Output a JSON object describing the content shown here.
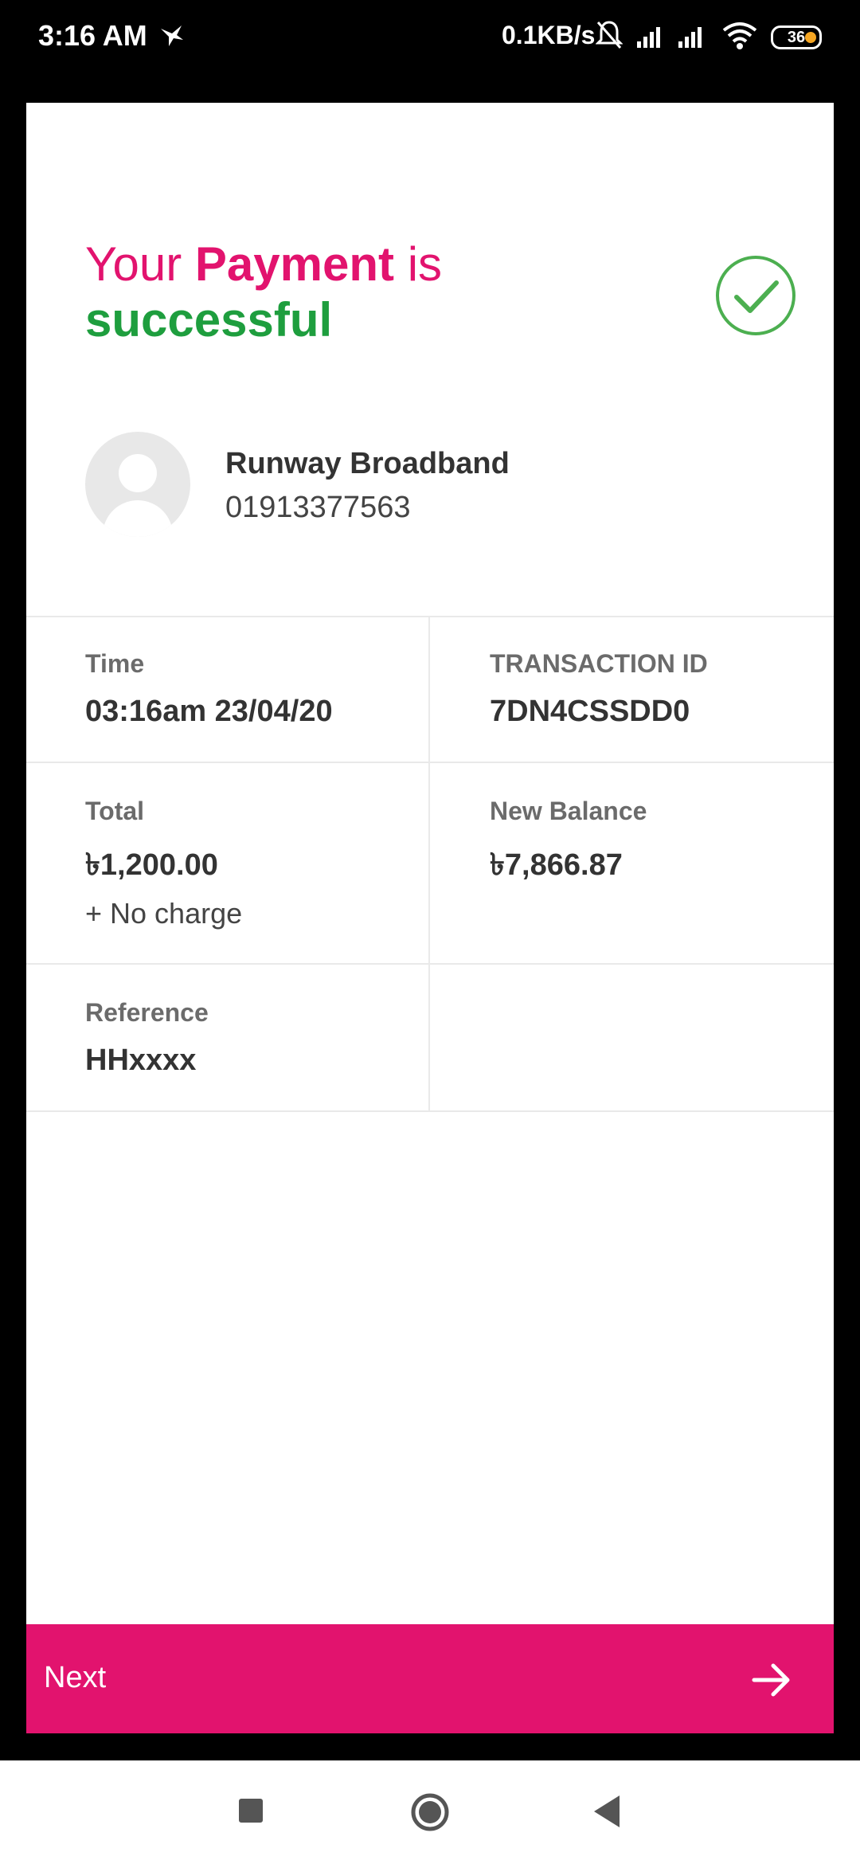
{
  "status_bar": {
    "time": "3:16 AM",
    "network_speed": "0.1KB/s",
    "battery_level": "36",
    "icons": [
      "bird-icon",
      "mute-bell-icon",
      "signal-icon",
      "signal-icon",
      "wifi-icon",
      "battery-icon"
    ]
  },
  "header": {
    "prefix": "Your",
    "highlight": "Payment",
    "suffix": "is",
    "status_word": "successful",
    "icon": "check-circle-icon"
  },
  "recipient": {
    "name": "Runway Broadband",
    "number": "01913377563",
    "avatar_icon": "user-avatar-icon"
  },
  "details": {
    "time_label": "Time",
    "time_value": "03:16am 23/04/20",
    "txn_label": "TRANSACTION ID",
    "txn_value": "7DN4CSSDD0",
    "total_label": "Total",
    "total_value": "৳1,200.00",
    "charge_note": "+ No charge",
    "balance_label": "New Balance",
    "balance_value": "৳7,866.87",
    "reference_label": "Reference",
    "reference_value": "HHxxxx"
  },
  "footer": {
    "next_label": "Next",
    "next_icon": "arrow-right-icon"
  },
  "nav_bar": {
    "icons": [
      "recents-square-icon",
      "home-circle-icon",
      "back-triangle-icon"
    ]
  },
  "colors": {
    "brand_pink": "#e2136e",
    "success_green": "#1e9e3e"
  }
}
